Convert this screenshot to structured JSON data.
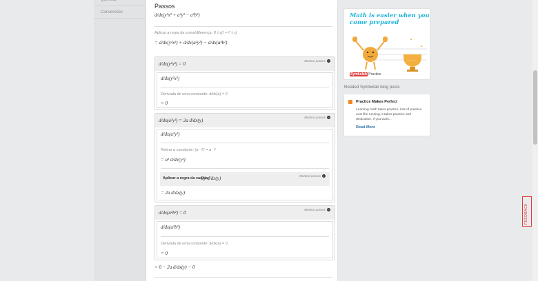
{
  "nav": {
    "items": [
      "Química",
      "Conversões"
    ]
  },
  "steps": {
    "title": "Passos",
    "line1": "d/dx(y²x² + a²y² − a²b²)",
    "sum_rule": "Aplicar a regra da soma/diferença:   (f ± g)′ = f′ ± g′",
    "line2": "= d/dx(y²x²) + d/dx(a²y²) − d/dx(a²b²)",
    "show_steps": "Mostrar passos",
    "box1": {
      "head": "d/dx(y²x²) = 0",
      "eq": "d/dx(y²x²)",
      "rule": "Derivada de uma constante:   d/dx(a) = 0",
      "res": "= 0"
    },
    "box2": {
      "head": "d/dx(a²y²) = 2a d/dx(y)",
      "eq": "d/dx(a²y²)",
      "rule": "Retirar a constante:   (a · f)′ = a · f′",
      "mid": "= a² d/dx(y²)",
      "chain_label": "Aplicar a regra da cadeia:",
      "chain_expr": "2y d/dx(y)",
      "res": "= 2a d/dx(y)"
    },
    "box3": {
      "head": "d/dx(a²b²) = 0",
      "eq": "d/dx(a²b²)",
      "rule": "Derivada de uma constante:   d/dx(a) = 0",
      "res": "= 0"
    },
    "final": "= 0 − 2a d/dx(y) − 0"
  },
  "promo": {
    "headline_1": "Math is easier when you",
    "headline_2": "come prepared",
    "brand": "Symbolab",
    "brand_suffix": "Practice"
  },
  "related": {
    "title": "Related Symbolab blog posts"
  },
  "blog": {
    "title": "Practice Makes Perfect",
    "body": "Learning math takes practice, lots of practice. Just like running, it takes practice and dedication. If you want...",
    "more": "Read More"
  },
  "feedback": "FEEDBACK",
  "colors": {
    "accent": "#1bb2d6",
    "brand_red": "#e23c3c",
    "blog_icon": "#f08a24"
  }
}
